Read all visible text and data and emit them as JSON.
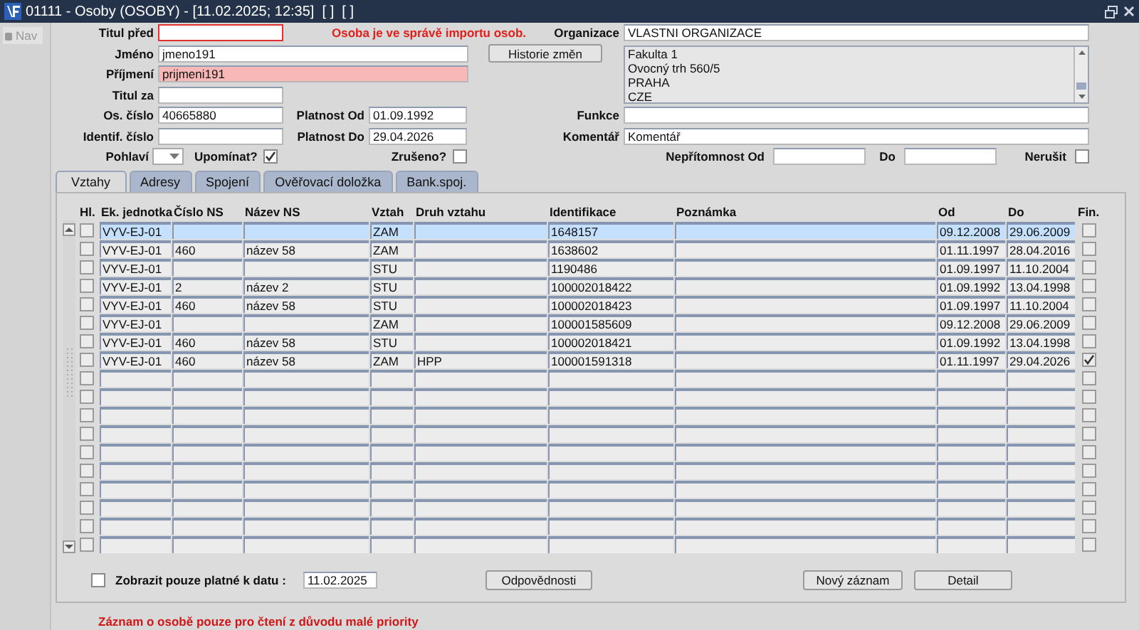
{
  "window": {
    "title": "01111 - Osoby (OSOBY) - [11.02.2025; 12:35]  [ ]  [ ]"
  },
  "nav": {
    "label": "Nav",
    "disabled": true
  },
  "form": {
    "titul_pred": {
      "label": "Titul před",
      "focused": true
    },
    "notice": "Osoba je ve správě importu osob.",
    "organizace": {
      "label": "Organizace",
      "value": "VLASTNI ORGANIZACE"
    },
    "jmeno": {
      "label": "Jméno",
      "value": "jmeno191"
    },
    "history_button": "Historie změn",
    "address": [
      "Fakulta 1",
      "Ovocný trh 560/5",
      "PRAHA",
      "CZE"
    ],
    "prijmeni": {
      "label": "Příjmení",
      "value": "prijmeni191",
      "required": true
    },
    "titul_za": {
      "label": "Titul za"
    },
    "os_cislo": {
      "label": "Os. číslo",
      "value": "40665880"
    },
    "platnost_od": {
      "label": "Platnost Od",
      "value": "01.09.1992"
    },
    "funkce": {
      "label": "Funkce"
    },
    "identif_cislo": {
      "label": "Identif. číslo"
    },
    "platnost_do": {
      "label": "Platnost Do",
      "value": "29.04.2026"
    },
    "komentar": {
      "label": "Komentář",
      "value": "Komentář"
    },
    "pohlavi": {
      "label": "Pohlaví"
    },
    "upominat": {
      "label": "Upomínat?",
      "checked": true
    },
    "zruseno": {
      "label": "Zrušeno?",
      "checked": false
    },
    "nepritomnost_od": {
      "label": "Nepřítomnost Od"
    },
    "nepritomnost_do": {
      "label": "Do"
    },
    "nerusit": {
      "label": "Nerušit",
      "checked": false
    }
  },
  "tabs": [
    {
      "label": "Vztahy",
      "selected": true
    },
    {
      "label": "Adresy",
      "selected": false
    },
    {
      "label": "Spojení",
      "selected": false
    },
    {
      "label": "Ověřovací doložka",
      "selected": false
    },
    {
      "label": "Bank.spoj.",
      "selected": false
    }
  ],
  "table": {
    "columns": [
      "Hl.",
      "Ek. jednotka",
      "Číslo NS",
      "Název NS",
      "Vztah",
      "Druh vztahu",
      "Identifikace",
      "Poznámka",
      "Od",
      "Do",
      "Fin."
    ],
    "rows": [
      {
        "selected": true,
        "hl": false,
        "fin": false,
        "ek": "VYV-EJ-01",
        "vztah": "ZAM",
        "ident": "1648157",
        "od": "09.12.2008",
        "do": "29.06.2009"
      },
      {
        "selected": false,
        "hl": false,
        "fin": false,
        "ek": "VYV-EJ-01",
        "cislo": "460",
        "nazev": "název 58",
        "vztah": "ZAM",
        "ident": "1638602",
        "od": "01.11.1997",
        "do": "28.04.2016"
      },
      {
        "selected": false,
        "hl": false,
        "fin": false,
        "ek": "VYV-EJ-01",
        "vztah": "STU",
        "ident": "1190486",
        "od": "01.09.1997",
        "do": "11.10.2004"
      },
      {
        "selected": false,
        "hl": false,
        "fin": false,
        "ek": "VYV-EJ-01",
        "cislo": "2",
        "nazev": "název 2",
        "vztah": "STU",
        "ident": "100002018422",
        "od": "01.09.1992",
        "do": "13.04.1998"
      },
      {
        "selected": false,
        "hl": false,
        "fin": false,
        "ek": "VYV-EJ-01",
        "cislo": "460",
        "nazev": "název 58",
        "vztah": "STU",
        "ident": "100002018423",
        "od": "01.09.1997",
        "do": "11.10.2004"
      },
      {
        "selected": false,
        "hl": false,
        "fin": false,
        "ek": "VYV-EJ-01",
        "vztah": "ZAM",
        "ident": "100001585609",
        "od": "09.12.2008",
        "do": "29.06.2009"
      },
      {
        "selected": false,
        "hl": false,
        "fin": false,
        "ek": "VYV-EJ-01",
        "cislo": "460",
        "nazev": "název 58",
        "vztah": "STU",
        "ident": "100002018421",
        "od": "01.09.1992",
        "do": "13.04.1998"
      },
      {
        "selected": false,
        "hl": false,
        "fin": true,
        "ek": "VYV-EJ-01",
        "cislo": "460",
        "nazev": "název 58",
        "vztah": "ZAM",
        "druh": "HPP",
        "ident": "100001591318",
        "od": "01.11.1997",
        "do": "29.04.2026"
      },
      {
        "selected": false,
        "hl": false,
        "fin": false
      },
      {
        "selected": false,
        "hl": false,
        "fin": false
      },
      {
        "selected": false,
        "hl": false,
        "fin": false
      },
      {
        "selected": false,
        "hl": false,
        "fin": false
      },
      {
        "selected": false,
        "hl": false,
        "fin": false
      },
      {
        "selected": false,
        "hl": false,
        "fin": false
      },
      {
        "selected": false,
        "hl": false,
        "fin": false
      },
      {
        "selected": false,
        "hl": false,
        "fin": false
      },
      {
        "selected": false,
        "hl": false,
        "fin": false
      },
      {
        "selected": false,
        "hl": false,
        "fin": false
      }
    ]
  },
  "footer": {
    "filter": {
      "label": "Zobrazit pouze platné k datu :",
      "checked": false,
      "value": "11.02.2025"
    },
    "buttons": [
      "Odpovědnosti",
      "Nový záznam",
      "Detail"
    ]
  },
  "status_message": "Záznam o osobě pouze pro čtení z důvodu malé priority"
}
